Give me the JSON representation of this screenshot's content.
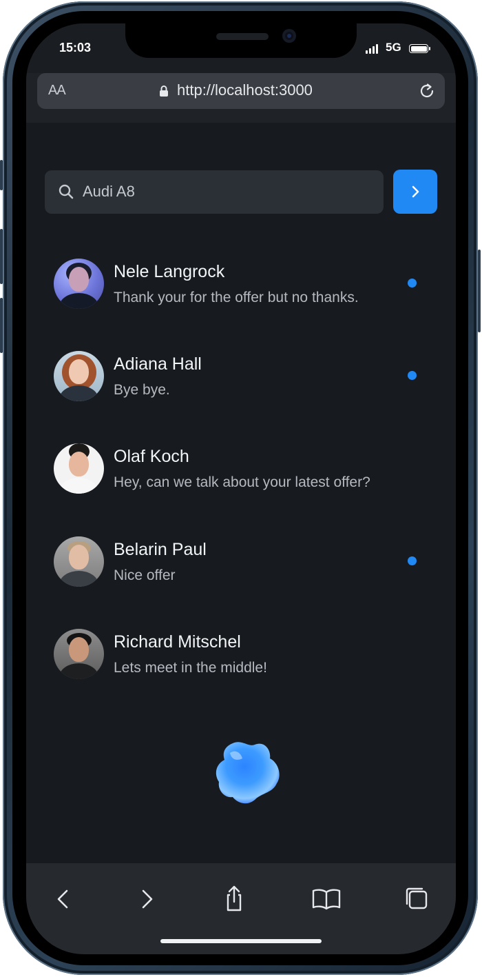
{
  "status_bar": {
    "time": "15:03",
    "network": "5G"
  },
  "browser": {
    "text_size_label": "AA",
    "url": "http://localhost:3000"
  },
  "search": {
    "value": "Audi A8",
    "icon": "search-icon",
    "submit_icon": "chevron-right-icon"
  },
  "conversations": [
    {
      "name": "Nele Langrock",
      "message": "Thank your for the offer but no thanks.",
      "unread": true
    },
    {
      "name": "Adiana Hall",
      "message": "Bye bye.",
      "unread": true
    },
    {
      "name": "Olaf Koch",
      "message": "Hey, can we talk about your latest offer?",
      "unread": false
    },
    {
      "name": "Belarin Paul",
      "message": "Nice offer",
      "unread": true
    },
    {
      "name": "Richard Mitschel",
      "message": "Lets meet in the middle!",
      "unread": false
    }
  ],
  "toolbar": {
    "items": [
      "back-icon",
      "forward-icon",
      "share-icon",
      "bookmarks-icon",
      "tabs-icon"
    ]
  },
  "colors": {
    "accent": "#2189f3",
    "background": "#171b20",
    "search_bg": "#2b3036"
  }
}
